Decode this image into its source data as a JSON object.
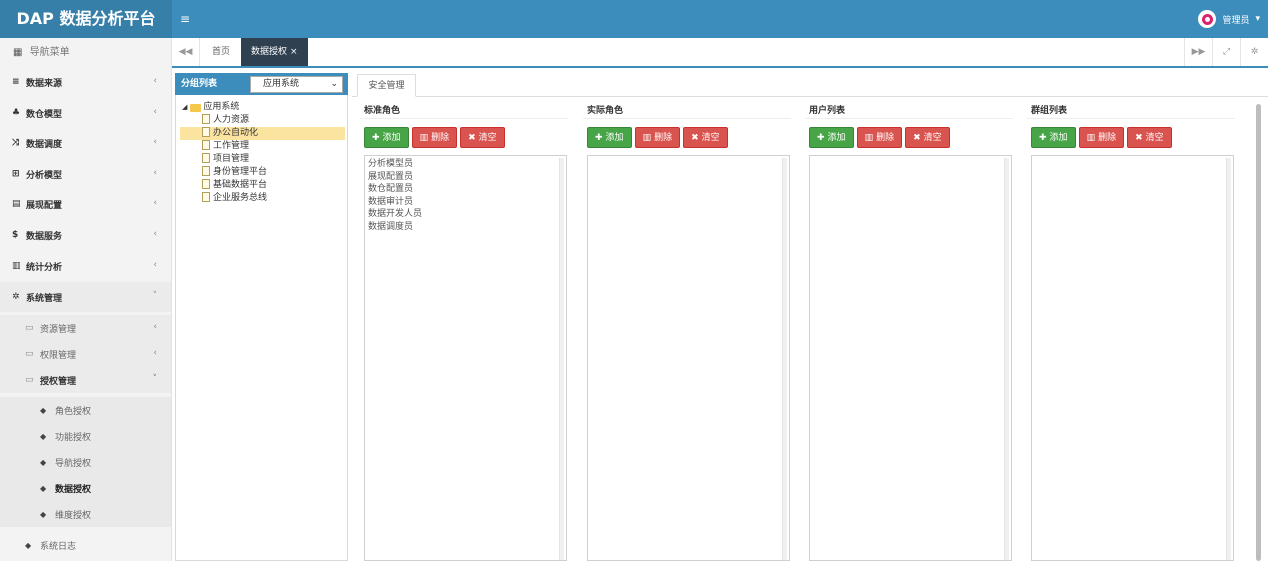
{
  "header": {
    "logo": "DAP 数据分析平台",
    "menu_toggle": "≡",
    "user": "管理员",
    "user_caret": "▾"
  },
  "sidebar": {
    "title": "导航菜单",
    "items": [
      {
        "label": "数据来源",
        "icon": "database-icon",
        "glyph": "≡",
        "chev": "‹"
      },
      {
        "label": "数仓模型",
        "icon": "cubes-icon",
        "glyph": "♣",
        "chev": "‹"
      },
      {
        "label": "数据调度",
        "icon": "shuffle-icon",
        "glyph": "⤨",
        "chev": "‹"
      },
      {
        "label": "分析模型",
        "icon": "sitemap-icon",
        "glyph": "⊞",
        "chev": "‹"
      },
      {
        "label": "展现配置",
        "icon": "film-icon",
        "glyph": "▤",
        "chev": "‹"
      },
      {
        "label": "数据服务",
        "icon": "dollar-icon",
        "glyph": "$",
        "chev": "‹"
      },
      {
        "label": "统计分析",
        "icon": "bar-chart-icon",
        "glyph": "▥",
        "chev": "‹"
      },
      {
        "label": "系统管理",
        "icon": "gear-icon",
        "glyph": "✲",
        "chev": "˅"
      }
    ],
    "sub_items": [
      {
        "label": "资源管理",
        "chev": "‹"
      },
      {
        "label": "权限管理",
        "chev": "‹"
      },
      {
        "label": "授权管理",
        "chev": "˅"
      }
    ],
    "leaves": [
      "角色授权",
      "功能授权",
      "导航授权",
      "数据授权",
      "维度授权"
    ],
    "log": "系统日志"
  },
  "tabbar": {
    "back": "◀◀",
    "home": "首页",
    "active_tab": "数据授权",
    "close": "×",
    "forward": "▶▶",
    "fullscreen": "⤢",
    "settings": "✲"
  },
  "group_panel": {
    "title": "分组列表",
    "select_value": "应用系统",
    "caret": "⌄",
    "tree_root": "应用系统",
    "tree_nodes": [
      "人力资源",
      "办公自动化",
      "工作管理",
      "项目管理",
      "身份管理平台",
      "基础数据平台",
      "企业服务总线"
    ],
    "selected_index": 1
  },
  "main": {
    "tab": "安全管理",
    "buttons": {
      "add": "添加",
      "delete": "删除",
      "clear": "清空"
    },
    "columns": [
      {
        "title": "标准角色",
        "items": [
          "分析模型员",
          "展现配置员",
          "数仓配置员",
          "数据审计员",
          "数据开发人员",
          "数据调度员"
        ]
      },
      {
        "title": "实际角色",
        "items": []
      },
      {
        "title": "用户列表",
        "items": []
      },
      {
        "title": "群组列表",
        "items": []
      }
    ]
  }
}
